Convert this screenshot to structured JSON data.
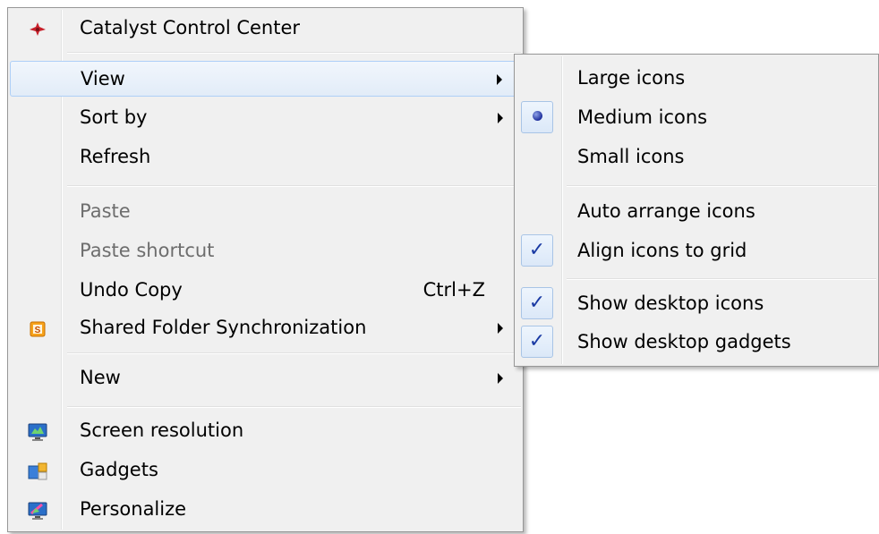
{
  "main_menu": {
    "items": [
      {
        "label": "Catalyst Control Center",
        "icon": "catalyst-icon"
      },
      {
        "label": "View"
      },
      {
        "label": "Sort by"
      },
      {
        "label": "Refresh"
      },
      {
        "label": "Paste"
      },
      {
        "label": "Paste shortcut"
      },
      {
        "label": "Undo Copy",
        "shortcut": "Ctrl+Z"
      },
      {
        "label": "Shared Folder Synchronization",
        "icon": "shared-folder-sync-icon"
      },
      {
        "label": "New"
      },
      {
        "label": "Screen resolution",
        "icon": "screen-resolution-icon"
      },
      {
        "label": "Gadgets",
        "icon": "gadgets-icon"
      },
      {
        "label": "Personalize",
        "icon": "personalize-icon"
      }
    ]
  },
  "view_submenu": {
    "items": [
      {
        "label": "Large icons"
      },
      {
        "label": "Medium icons",
        "selected": true
      },
      {
        "label": "Small icons"
      },
      {
        "label": "Auto arrange icons"
      },
      {
        "label": "Align icons to grid",
        "checked": true
      },
      {
        "label": "Show desktop icons",
        "checked": true
      },
      {
        "label": "Show desktop gadgets",
        "checked": true
      }
    ]
  },
  "colors": {
    "menu_background": "#f0f0f0",
    "hover_border": "#aecff7",
    "disabled_text": "#6d6d6d",
    "check_color": "#1a3aa3"
  }
}
